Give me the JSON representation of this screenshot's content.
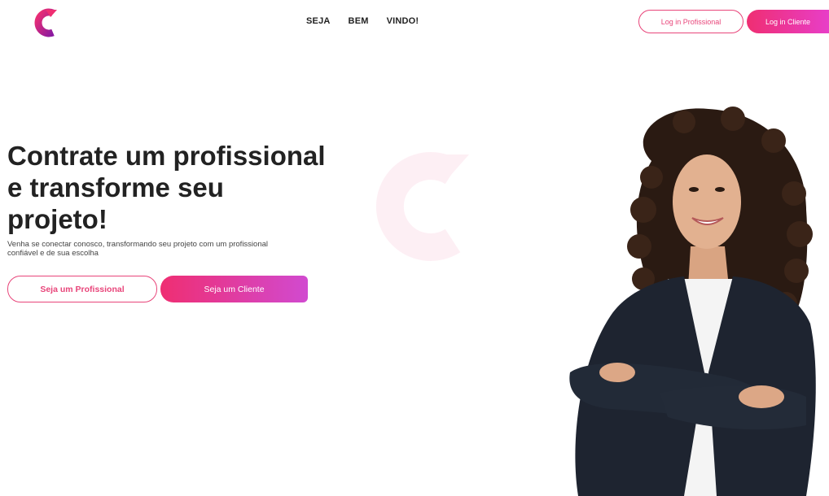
{
  "header": {
    "nav": [
      "SEJA",
      "BEM",
      "VINDO!"
    ],
    "login_professional": "Log in Profissional",
    "login_client": "Log in Cliente"
  },
  "hero": {
    "headline_lines": [
      "Contrate um profissional",
      "e transforme seu",
      "projeto!"
    ],
    "subtitle_lines": [
      "Venha se conectar conosco, transformando seu projeto com um profissional",
      "confiável e de sua escolha"
    ],
    "cta_professional": "Seja um Profissional",
    "cta_client": "Seja um Cliente"
  },
  "colors": {
    "accent_pink": "#ef2e72",
    "accent_magenta": "#d14ad0",
    "outline": "#e8457a"
  },
  "icons": {
    "logo": "c-logo-icon",
    "watermark": "c-logo-watermark"
  }
}
